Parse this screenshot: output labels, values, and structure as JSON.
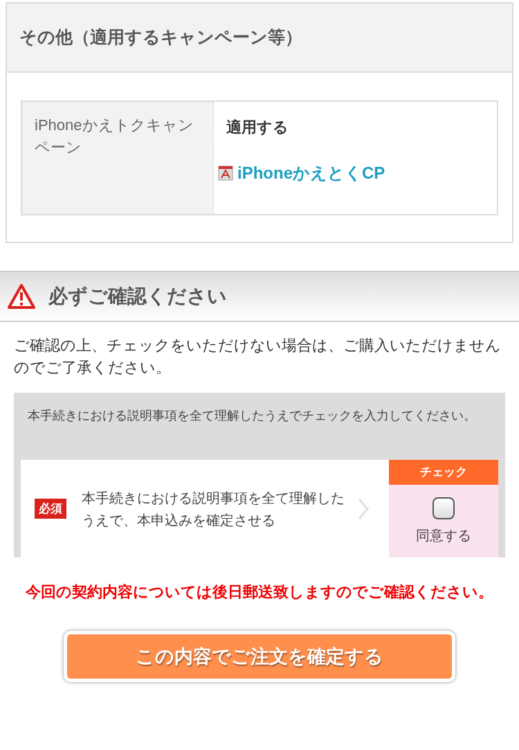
{
  "other_section": {
    "title": "その他（適用するキャンペーン等）",
    "rows": [
      {
        "label": "iPhoneかえトクキャンペーン",
        "value": "適用する",
        "link": "iPhoneかえとくCP"
      }
    ]
  },
  "confirm_section": {
    "title": "必ずご確認ください",
    "notice": "ご確認の上、チェックをいただけない場合は、ご購入いただけませんのでご了承ください。",
    "instruction": "本手続きにおける説明事項を全て理解したうえでチェックを入力してください。",
    "items": [
      {
        "badge": "必須",
        "text": "本手続きにおける説明事項を全て理解したうえで、本申込みを確定させる",
        "check_header": "チェック",
        "check_label": "同意する",
        "checked": false
      }
    ]
  },
  "warning": "今回の契約内容については後日郵送致しますのでご確認ください。",
  "submit_button": "この内容でご注文を確定する"
}
